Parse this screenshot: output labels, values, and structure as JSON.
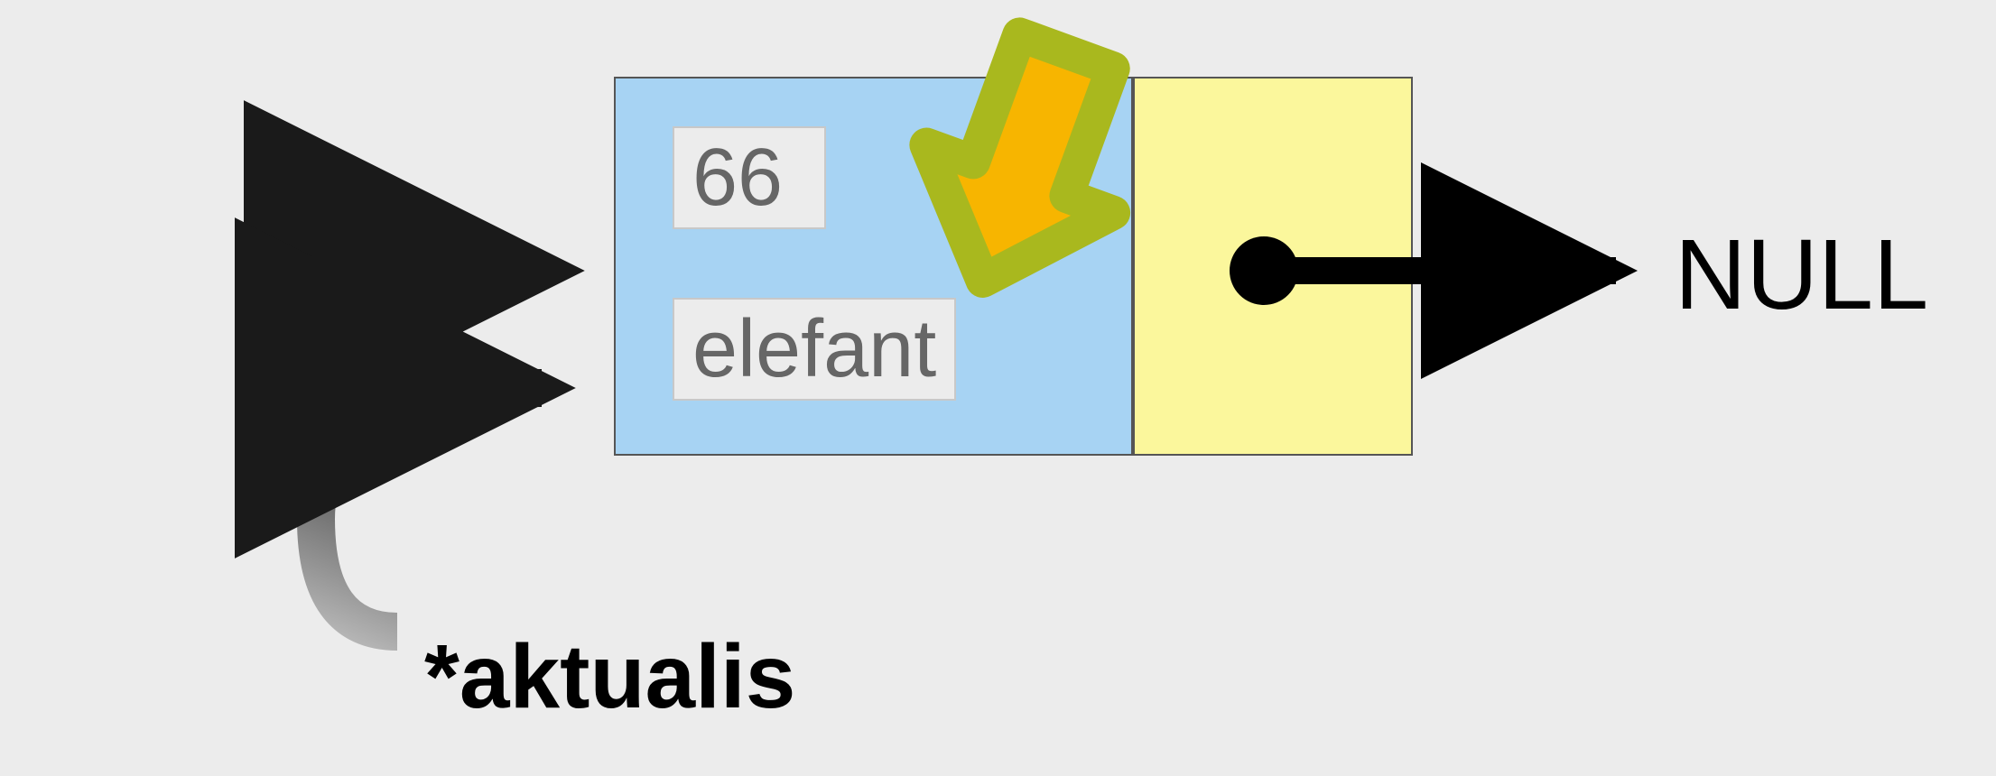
{
  "node": {
    "value1": "66",
    "value2": "elefant"
  },
  "nextPointerTarget": "NULL",
  "currentPointerLabel": "*aktualis"
}
